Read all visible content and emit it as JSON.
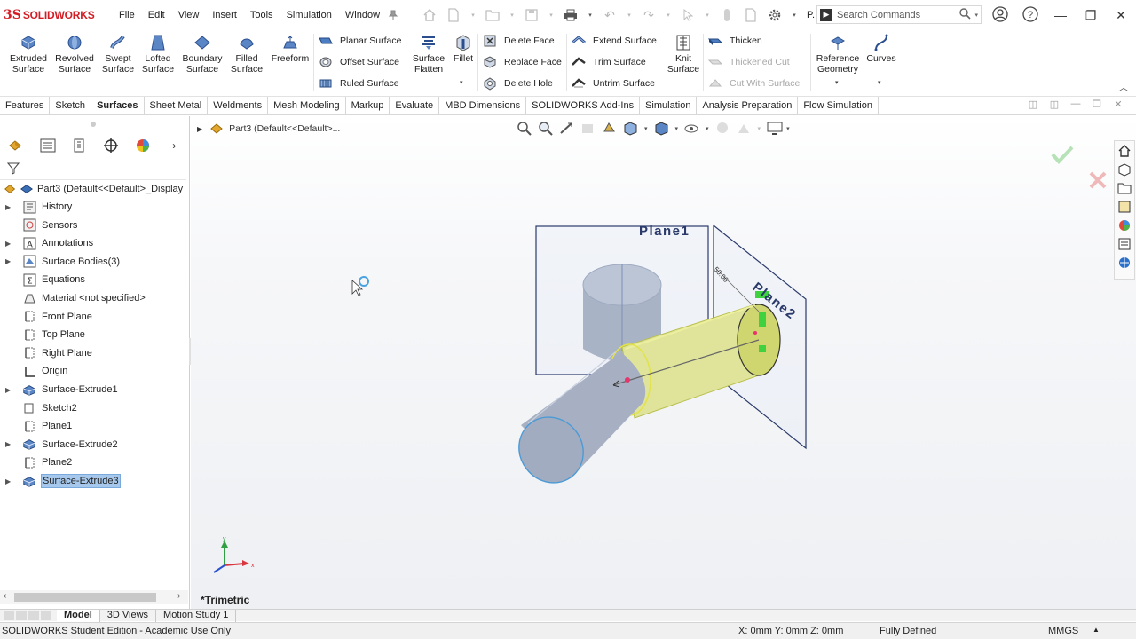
{
  "app": {
    "brand_prefix": "3S",
    "brand": "SOLIDWORKS",
    "menus": [
      "File",
      "Edit",
      "View",
      "Insert",
      "Tools",
      "Simulation",
      "Window"
    ],
    "title_abbrev": "P...",
    "search_placeholder": "Search Commands"
  },
  "ribbon": {
    "big_tools": [
      {
        "l1": "Extruded",
        "l2": "Surface",
        "icon": "extruded-surface-icon"
      },
      {
        "l1": "Revolved",
        "l2": "Surface",
        "icon": "revolved-surface-icon"
      },
      {
        "l1": "Swept",
        "l2": "Surface",
        "icon": "swept-surface-icon"
      },
      {
        "l1": "Lofted",
        "l2": "Surface",
        "icon": "lofted-surface-icon"
      },
      {
        "l1": "Boundary",
        "l2": "Surface",
        "icon": "boundary-surface-icon"
      },
      {
        "l1": "Filled",
        "l2": "Surface",
        "icon": "filled-surface-icon"
      },
      {
        "l1": "Freeform",
        "l2": "",
        "icon": "freeform-icon"
      }
    ],
    "col1": [
      "Planar Surface",
      "Offset Surface",
      "Ruled Surface"
    ],
    "surface_flatten": {
      "l1": "Surface",
      "l2": "Flatten"
    },
    "fillet": "Fillet",
    "col2": [
      "Delete Face",
      "Replace Face",
      "Delete Hole"
    ],
    "col3": [
      "Extend Surface",
      "Trim Surface",
      "Untrim Surface"
    ],
    "knit": {
      "l1": "Knit",
      "l2": "Surface"
    },
    "col4": [
      "Thicken",
      "Thickened Cut",
      "Cut With Surface"
    ],
    "ref_geometry": {
      "l1": "Reference",
      "l2": "Geometry"
    },
    "curves": "Curves"
  },
  "tabs": [
    "Features",
    "Sketch",
    "Surfaces",
    "Sheet Metal",
    "Weldments",
    "Mesh Modeling",
    "Markup",
    "Evaluate",
    "MBD Dimensions",
    "SOLIDWORKS Add-Ins",
    "Simulation",
    "Analysis Preparation",
    "Flow Simulation"
  ],
  "active_tab": "Surfaces",
  "tree": {
    "root": "Part3  (Default<<Default>_Display",
    "items": [
      {
        "label": "History",
        "expand": true,
        "icon": "history-icon"
      },
      {
        "label": "Sensors",
        "expand": false,
        "icon": "sensors-icon"
      },
      {
        "label": "Annotations",
        "expand": true,
        "icon": "annotations-icon"
      },
      {
        "label": "Surface Bodies(3)",
        "expand": true,
        "icon": "surface-bodies-icon"
      },
      {
        "label": "Equations",
        "expand": false,
        "icon": "equations-icon"
      },
      {
        "label": "Material <not specified>",
        "expand": false,
        "icon": "material-icon"
      },
      {
        "label": "Front Plane",
        "expand": false,
        "icon": "plane-icon"
      },
      {
        "label": "Top Plane",
        "expand": false,
        "icon": "plane-icon"
      },
      {
        "label": "Right Plane",
        "expand": false,
        "icon": "plane-icon"
      },
      {
        "label": "Origin",
        "expand": false,
        "icon": "origin-icon"
      },
      {
        "label": "Surface-Extrude1",
        "expand": true,
        "icon": "surface-extrude-icon"
      },
      {
        "label": "Sketch2",
        "expand": false,
        "icon": "sketch-icon"
      },
      {
        "label": "Plane1",
        "expand": false,
        "icon": "plane-icon"
      },
      {
        "label": "Surface-Extrude2",
        "expand": true,
        "icon": "surface-extrude-icon"
      },
      {
        "label": "Plane2",
        "expand": false,
        "icon": "plane-icon"
      },
      {
        "label": "Surface-Extrude3",
        "expand": true,
        "icon": "surface-extrude-icon",
        "selected": true
      }
    ]
  },
  "viewport": {
    "breadcrumb": "Part3  (Default<<Default>...",
    "view_name": "*Trimetric",
    "plane1_label": "Plane1",
    "plane2_label": "Plane2",
    "dim_label": "50.00"
  },
  "bottom_tabs": [
    "Model",
    "3D Views",
    "Motion Study 1"
  ],
  "status": {
    "edition": "SOLIDWORKS Student Edition - Academic Use Only",
    "coords": "X: 0mm Y: 0mm Z: 0mm",
    "state": "Fully Defined",
    "units": "MMGS"
  },
  "colors": {
    "brand_red": "#d31e25",
    "selection_blue": "#a6c8ec",
    "surface_gray": "#a9b3c6",
    "surface_yellow": "#dfe49a"
  }
}
